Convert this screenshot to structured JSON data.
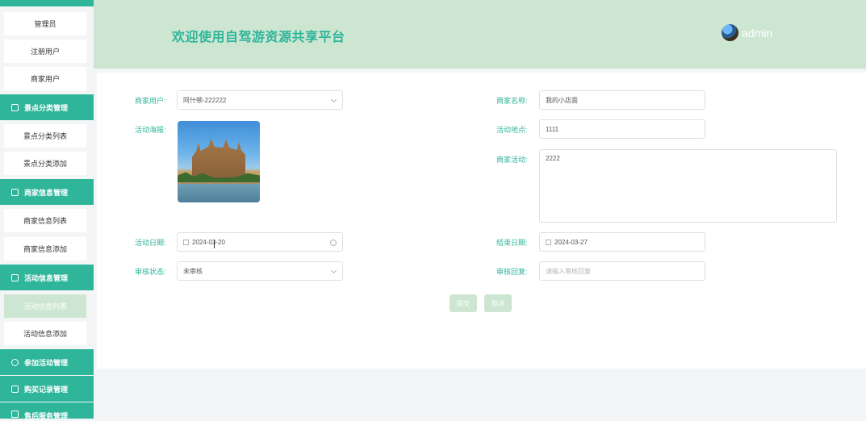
{
  "sidebar": {
    "items": [
      {
        "label": "管理员"
      },
      {
        "label": "注册用户"
      },
      {
        "label": "商家用户"
      }
    ],
    "groups": [
      {
        "label": "景点分类管理",
        "children": [
          {
            "label": "景点分类列表"
          },
          {
            "label": "景点分类添加"
          }
        ]
      },
      {
        "label": "商家信息管理",
        "children": [
          {
            "label": "商家信息列表"
          },
          {
            "label": "商家信息添加"
          }
        ]
      },
      {
        "label": "活动信息管理",
        "children": [
          {
            "label": "活动信息列表"
          },
          {
            "label": "活动信息添加"
          }
        ]
      },
      {
        "label": "参加活动管理"
      },
      {
        "label": "购买记录管理"
      },
      {
        "label": "售后服务管理"
      }
    ]
  },
  "header": {
    "title": "欢迎使用自驾游资源共享平台",
    "username": "admin"
  },
  "form": {
    "merchant_user": {
      "label": "商家用户:",
      "value": "阿什顿-222222"
    },
    "merchant_name": {
      "label": "商家名称:",
      "value": "我的小店面"
    },
    "poster": {
      "label": "活动海报:"
    },
    "location": {
      "label": "活动地点:",
      "value": "1111"
    },
    "merchant_activity": {
      "label": "商家活动:",
      "value": "2222"
    },
    "start_date": {
      "label": "活动日期:",
      "value": "2024-03-20"
    },
    "end_date": {
      "label": "结束日期:",
      "value": "2024-03-27"
    },
    "review_status": {
      "label": "审核状态:",
      "value": "未审核"
    },
    "review_reply": {
      "label": "审核回复:",
      "placeholder": "请输入审核回复"
    },
    "submit_label": "提交",
    "cancel_label": "取消"
  },
  "colors": {
    "accent": "#2fb59a",
    "header_bg": "#cde6d2",
    "button_bg": "#cde6d2"
  }
}
